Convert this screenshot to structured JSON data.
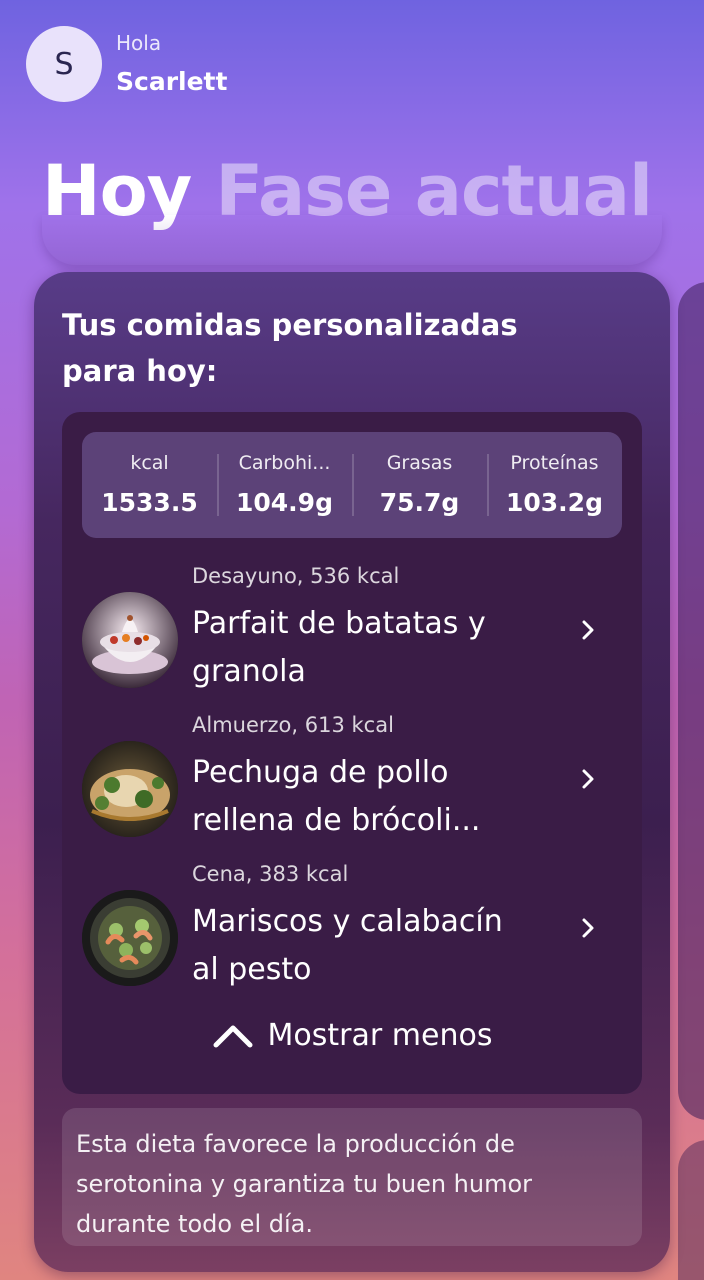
{
  "user": {
    "avatar_initial": "S",
    "greeting": "Hola",
    "name": "Scarlett"
  },
  "tabs": [
    {
      "label": "Hoy",
      "active": true
    },
    {
      "label": "Fase actual",
      "active": false
    }
  ],
  "card": {
    "title": "Tus comidas personalizadas para hoy:",
    "stats": [
      {
        "label": "kcal",
        "value": "1533.5"
      },
      {
        "label": "Carbohi...",
        "value": "104.9g"
      },
      {
        "label": "Grasas",
        "value": "75.7g"
      },
      {
        "label": "Proteínas",
        "value": "103.2g"
      }
    ],
    "meals": [
      {
        "subtitle": "Desayuno, 536 kcal",
        "name": "Parfait de batatas y granola",
        "icon": "parfait-photo"
      },
      {
        "subtitle": "Almuerzo, 613 kcal",
        "name": "Pechuga de pollo rellena de brócoli...",
        "icon": "stuffed-chicken-photo"
      },
      {
        "subtitle": "Cena, 383 kcal",
        "name": "Mariscos y calabacín al pesto",
        "icon": "seafood-zucchini-photo"
      }
    ],
    "toggle_label": "Mostrar menos",
    "note": "Esta dieta favorece la producción de serotonina y garantiza tu buen humor durante todo el día."
  },
  "colors": {
    "accent_text": "#ffffff",
    "inactive_tab": "#d6c6f3",
    "card_bg": "#3a1c46",
    "stats_bg": "#5c4278"
  }
}
